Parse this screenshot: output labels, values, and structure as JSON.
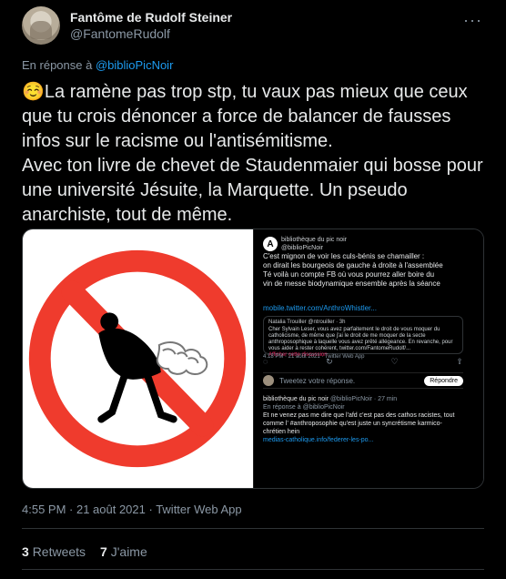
{
  "tweet": {
    "display_name": "Fantôme de Rudolf Steiner",
    "handle": "@FantomeRudolf",
    "reply_prefix": "En réponse à ",
    "reply_to": "@biblioPicNoir",
    "text": "La ramène pas trop stp, tu vaux pas mieux que ceux que tu crois dénoncer a force de balancer de fausses infos sur le racisme ou l'antisémitisme.\nAvec ton livre de chevet de Staudenmaier qui bosse pour une université Jésuite, la Marquette. Un pseudo anarchiste, tout de même.",
    "emoji": "☺️",
    "time": "4:55 PM · 21 août 2021 · Twitter Web App",
    "retweets": "3",
    "retweets_label": "Retweets",
    "likes": "7",
    "likes_label": "J'aime"
  },
  "embed": {
    "name": "bibliothèque du pic noir",
    "handle": "@biblioPicNoir",
    "text": "C'est mignon de voir les culs-bénis se chamailler :\non dirait les bourgeois de gauche à droite à l'assemblée\nTé voilà un compte FB où vous pourrez aller boire du\nvin de messe biodynamique ensemble après la séance",
    "link": "mobile.twitter.com/AnthroWhistler...",
    "quote_user": "Natalia Trouiller",
    "quote_handle": "@ntrouiller · 3h",
    "quote_text": "Cher Sylvain Leser, vous avez parfaitement le droit de vous moquer du catholicisme, de même que j'ai le droit de me moquer de la secte anthroposophique à laquelle vous avez prêté allégeance.\nEn revanche, pour vous aider à rester cohérent, twitter.com/FantomeRudolf/...",
    "quote_show": "Afficher cette discussion",
    "quote_time": "4:18 PM · 21 août 2021 · Twitter Web App",
    "reply_placeholder": "Tweetez votre réponse.",
    "reply_button": "Répondre",
    "second_name": "bibliothèque du pic noir",
    "second_handle": "@biblioPicNoir · 27 min",
    "second_reply": "En réponse à @biblioPicNoir",
    "second_text": "Et ne venez pas me dire que l'afd c'est pas des cathos racistes, tout comme l' #anthroposophie qu'est juste un syncrétisme karmico-chrétien hein",
    "second_link": "medias-catholique.info/federer-les-po..."
  },
  "colors": {
    "background": "#000000",
    "text": "#e7e9ea",
    "muted": "#8b98a5",
    "accent": "#1d9bf0",
    "prohibition": "#ef3b2d"
  }
}
